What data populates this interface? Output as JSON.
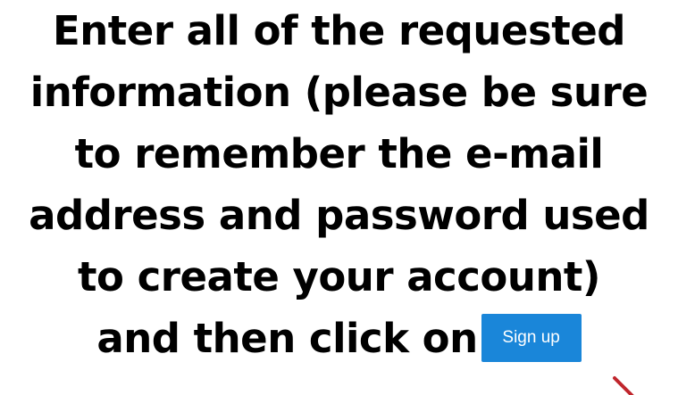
{
  "instruction": {
    "line1": "Enter all of the requested",
    "line2": "information (please be sure",
    "line3": "to remember the e-mail",
    "line4": "address and password used",
    "line5": "to create your account)",
    "line6": "and then click on"
  },
  "signup_button": {
    "label": "Sign up",
    "color": "#1a86d9"
  },
  "arrow": {
    "icon": "arrow-icon",
    "color": "#c0262d"
  }
}
